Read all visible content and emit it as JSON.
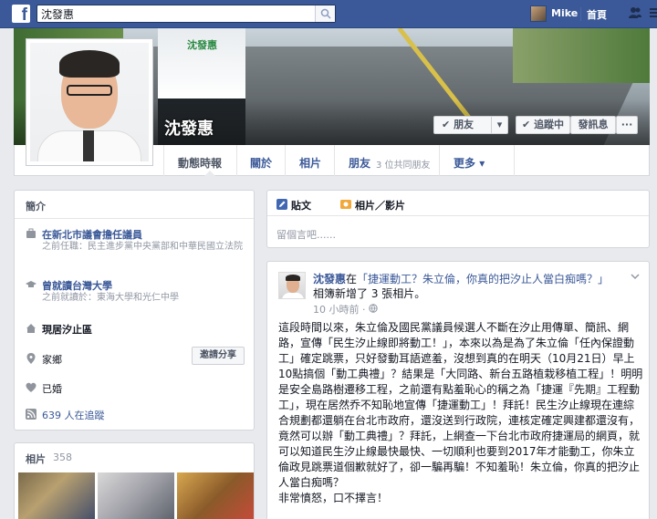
{
  "topbar": {
    "logo": "f",
    "search_value": "沈發惠",
    "user_name": "Mike",
    "home_label": "首頁",
    "icons": [
      "search-icon",
      "friend-requests-icon",
      "more-icon"
    ]
  },
  "profile": {
    "name": "沈發惠",
    "cover_shirt_text": "沈發惠",
    "buttons": {
      "friends": "朋友",
      "following": "追蹤中",
      "message": "發訊息",
      "more": "···"
    }
  },
  "tabs": {
    "timeline": "動態時報",
    "about": "關於",
    "photos": "相片",
    "friends": "朋友",
    "friends_count": "3 位共同朋友",
    "more": "更多"
  },
  "about": {
    "title": "簡介",
    "work_main": "在新北市議會擔任議員",
    "work_sub": "之前任職：民主進步黨中央黨部和中華民國立法院",
    "edu_main": "曾就讀台灣大學",
    "edu_sub": "之前就讀於：東海大學和光仁中學",
    "live": "現居汐止區",
    "hometown": "家鄉",
    "invite_btn": "邀請分享",
    "relationship": "已婚",
    "followers": "639 人在追蹤"
  },
  "photos": {
    "title": "相片",
    "count": "358"
  },
  "composer": {
    "status_tab": "貼文",
    "photo_tab": "相片／影片",
    "placeholder": "留個言吧......"
  },
  "post": {
    "author": "沈發惠",
    "in_text": "在",
    "title_link": "「捷運動工？朱立倫，你真的把汐止人當白痴嗎？」",
    "added": "相簿新增了 3 張相片。",
    "time": "10 小時前 · ",
    "body": "這段時間以來，朱立倫及國民黨議員候選人不斷在汐止用傳單、簡訊、網路，宣傳「民生汐止線即將動工！」，本來以為是為了朱立倫「任內保證動工」確定跳票，只好發動耳語遮羞，沒想到真的在明天（10月21日）早上10點搞個「動工典禮」？結果是「大同路、新台五路植栽移植工程」！明明是安全島路樹遷移工程，之前還有點羞恥心的稱之為「捷運『先期』工程動工」，現在居然乔不知恥地宣傳「捷運動工」！拜託！民生汐止線現在連綜合規劃都還躺在台北市政府，還沒送到行政院，連核定確定興建都還沒有，竟然可以辦「動工典禮」？拜託，上網查一下台北市政府捷運局的網頁，就可以知道民生汐止線最快最快、一切順利也要到2017年才能動工，你朱立倫政見跳票道個歉就好了，卻一騙再騙！不知羞恥！朱立倫，你真的把汐止人當白痴嗎？",
    "closing": "非常憤怒，口不擇言！"
  },
  "colors": {
    "brand": "#3b5998",
    "link": "#3b5998",
    "background": "#e9eaed",
    "muted": "#9197a3"
  }
}
